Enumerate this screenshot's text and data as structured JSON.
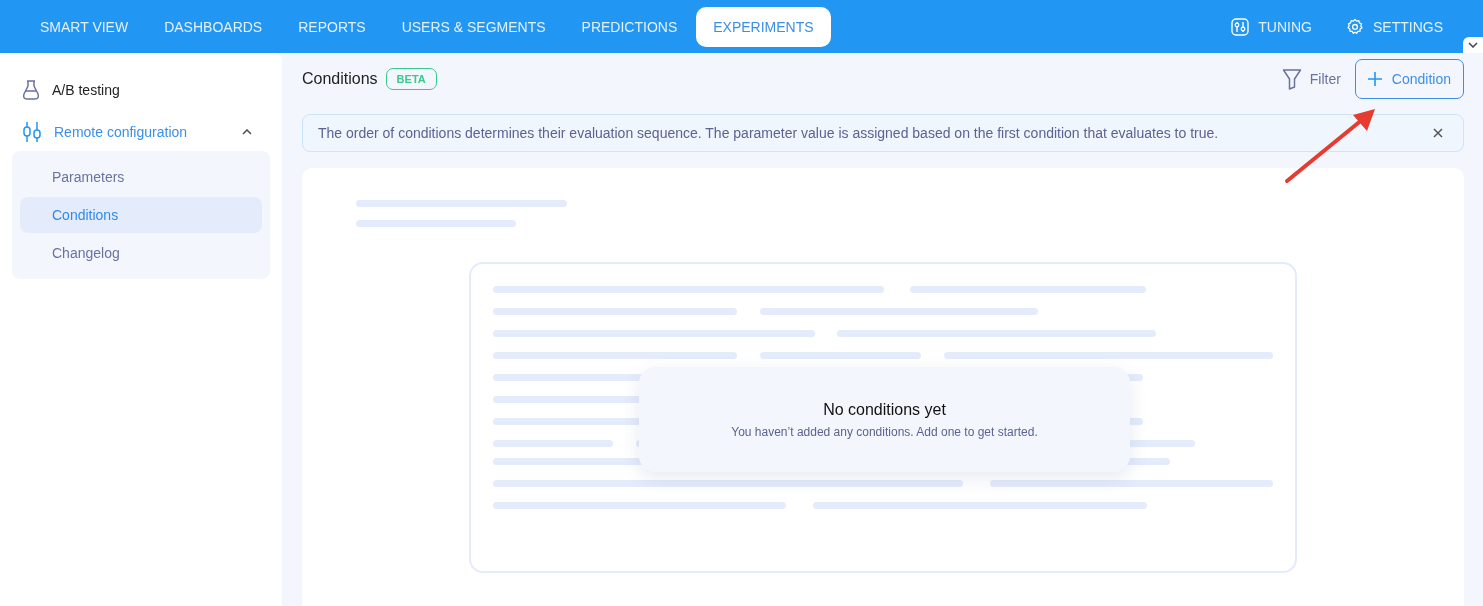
{
  "nav": {
    "tabs": [
      {
        "label": "SMART VIEW",
        "selected": false
      },
      {
        "label": "DASHBOARDS",
        "selected": false
      },
      {
        "label": "REPORTS",
        "selected": false
      },
      {
        "label": "USERS & SEGMENTS",
        "selected": false
      },
      {
        "label": "PREDICTIONS",
        "selected": false
      },
      {
        "label": "EXPERIMENTS",
        "selected": true
      }
    ],
    "actions": [
      {
        "kind": "tuning",
        "label": "TUNING"
      },
      {
        "kind": "settings",
        "label": "SETTINGS"
      }
    ]
  },
  "sidebar": {
    "items": [
      {
        "kind": "flask",
        "label": "A/B testing",
        "selected": false
      },
      {
        "kind": "sliders",
        "label": "Remote configuration",
        "selected": true,
        "expanded": true,
        "children": [
          {
            "label": "Parameters",
            "selected": false
          },
          {
            "label": "Conditions",
            "selected": true
          },
          {
            "label": "Changelog",
            "selected": false
          }
        ]
      }
    ]
  },
  "header": {
    "title": "Conditions",
    "badge": "BETA",
    "filter": "Filter",
    "add_button": "Condition"
  },
  "banner": {
    "text": "The order of conditions determines their evaluation sequence. The parameter value is assigned based on the first condition that evaluates to true."
  },
  "empty_state": {
    "title": "No conditions yet",
    "message": "You haven’t added any conditions. Add one to get started."
  }
}
